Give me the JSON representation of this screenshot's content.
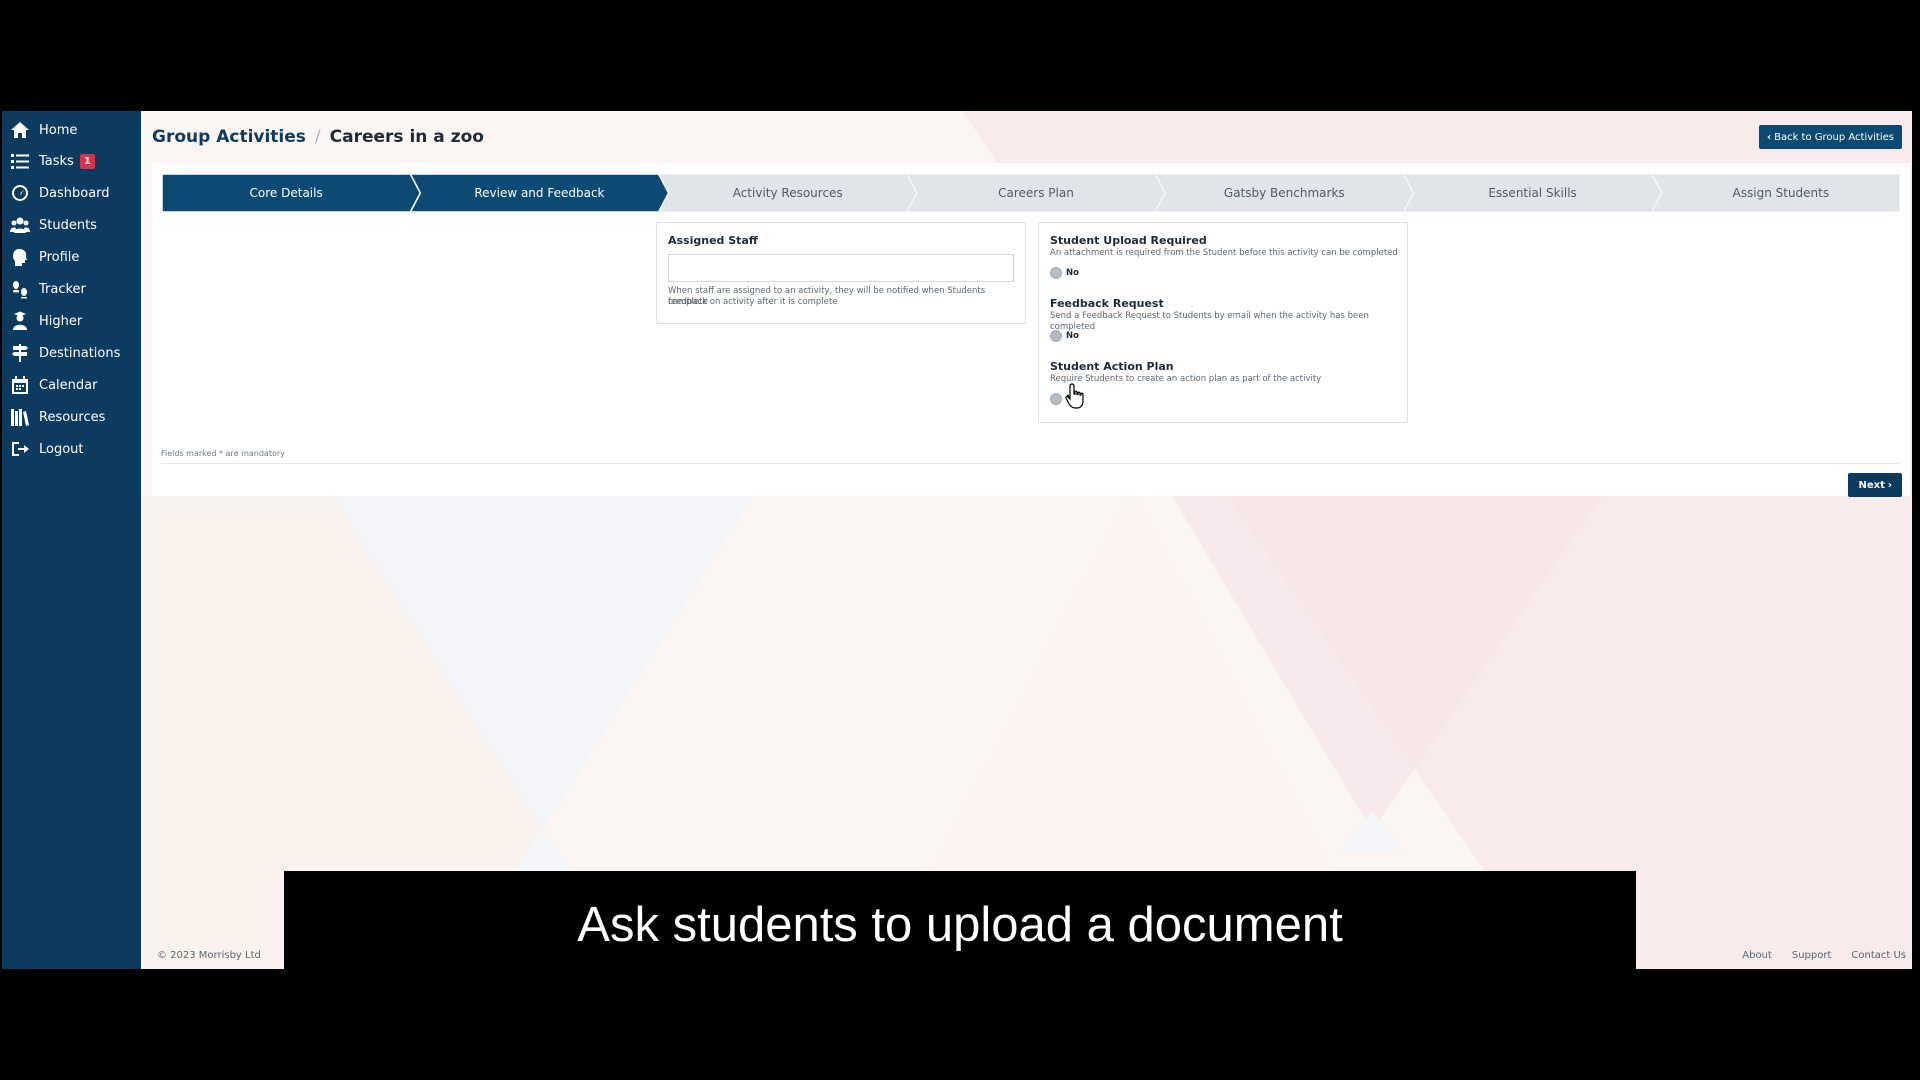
{
  "colors": {
    "sidebar": "#0d3a5f",
    "accent": "#0d4a73",
    "badge": "#d93147",
    "step_done": "#0d4a73",
    "step_todo": "#e1e5e9"
  },
  "sidebar": {
    "items": [
      {
        "label": "Home",
        "icon": "home-icon"
      },
      {
        "label": "Tasks",
        "icon": "tasks-icon",
        "badge": "1"
      },
      {
        "label": "Dashboard",
        "icon": "dashboard-icon"
      },
      {
        "label": "Students",
        "icon": "students-icon"
      },
      {
        "label": "Profile",
        "icon": "profile-icon"
      },
      {
        "label": "Tracker",
        "icon": "tracker-icon"
      },
      {
        "label": "Higher",
        "icon": "graduation-cap-icon"
      },
      {
        "label": "Destinations",
        "icon": "signpost-icon"
      },
      {
        "label": "Calendar",
        "icon": "calendar-icon"
      },
      {
        "label": "Resources",
        "icon": "books-icon"
      },
      {
        "label": "Logout",
        "icon": "logout-icon"
      }
    ]
  },
  "header": {
    "breadcrumb_parent": "Group Activities",
    "breadcrumb_separator": "/",
    "breadcrumb_current": "Careers in a zoo",
    "back_button": "Back to Group Activities"
  },
  "stepper": {
    "steps": [
      {
        "label": "Core Details",
        "state": "done"
      },
      {
        "label": "Review and Feedback",
        "state": "done"
      },
      {
        "label": "Activity Resources",
        "state": "todo"
      },
      {
        "label": "Careers Plan",
        "state": "todo"
      },
      {
        "label": "Gatsby Benchmarks",
        "state": "todo"
      },
      {
        "label": "Essential Skills",
        "state": "todo"
      },
      {
        "label": "Assign Students",
        "state": "todo"
      }
    ]
  },
  "assigned_staff": {
    "title": "Assigned Staff",
    "value": "",
    "help_line1": "When staff are assigned to an activity, they will be notified when Students complete",
    "help_line2": "feedback on activity after it is complete"
  },
  "options": {
    "student_upload": {
      "title": "Student Upload Required",
      "desc": "An attachment is required from the Student before this activity can be completed",
      "value": "No"
    },
    "feedback_request": {
      "title": "Feedback Request",
      "desc": "Send a Feedback Request to Students by email when the activity has been completed",
      "value": "No"
    },
    "action_plan": {
      "title": "Student Action Plan",
      "desc": "Require Students to create an action plan as part of the activity",
      "value": "No"
    }
  },
  "form": {
    "mandatory_note": "Fields marked * are mandatory",
    "next_button": "Next"
  },
  "footer": {
    "copyright": "© 2023 Morrisby Ltd",
    "links": [
      "About",
      "Support",
      "Contact Us"
    ]
  },
  "caption": "Ask students to upload a document"
}
